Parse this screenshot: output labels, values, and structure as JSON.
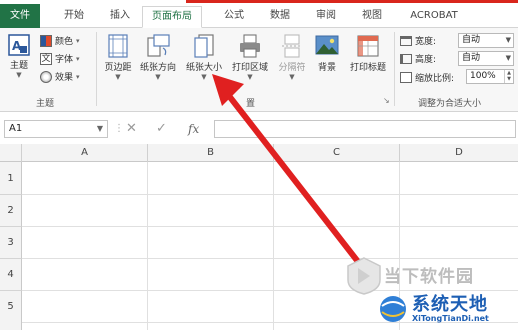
{
  "colors": {
    "accent": "#217346",
    "red_arrow": "#e02020",
    "red_bar": "#d9261c"
  },
  "tabs": [
    "文件",
    "开始",
    "插入",
    "页面布局",
    "公式",
    "数据",
    "审阅",
    "视图",
    "ACROBAT"
  ],
  "active_tab": "页面布局",
  "ribbon": {
    "theme_group": {
      "label": "主题",
      "theme_button": "主题",
      "colors": "颜色",
      "fonts": "字体",
      "effects": "效果"
    },
    "page_setup_group": {
      "label": "页面设置",
      "label_visible_fragment": "置",
      "margins": "页边距",
      "orientation": "纸张方向",
      "size": "纸张大小",
      "print_area": "打印区域",
      "breaks": "分隔符",
      "background": "背景",
      "print_titles": "打印标题"
    },
    "scale_group": {
      "label": "调整为合适大小",
      "width_label": "宽度:",
      "width_value": "自动",
      "height_label": "高度:",
      "height_value": "自动",
      "scale_label": "缩放比例:",
      "scale_value": "100%"
    }
  },
  "formula_bar": {
    "name_box": "A1",
    "cancel": "✕",
    "enter": "✓",
    "fx": "fx",
    "value": ""
  },
  "sheet": {
    "columns": [
      "A",
      "B",
      "C",
      "D"
    ],
    "rows": [
      "1",
      "2",
      "3",
      "4",
      "5"
    ]
  },
  "watermark": {
    "line1": "当下软件园",
    "line2": "系统天地",
    "line3": "XiTongTianDi.net"
  }
}
